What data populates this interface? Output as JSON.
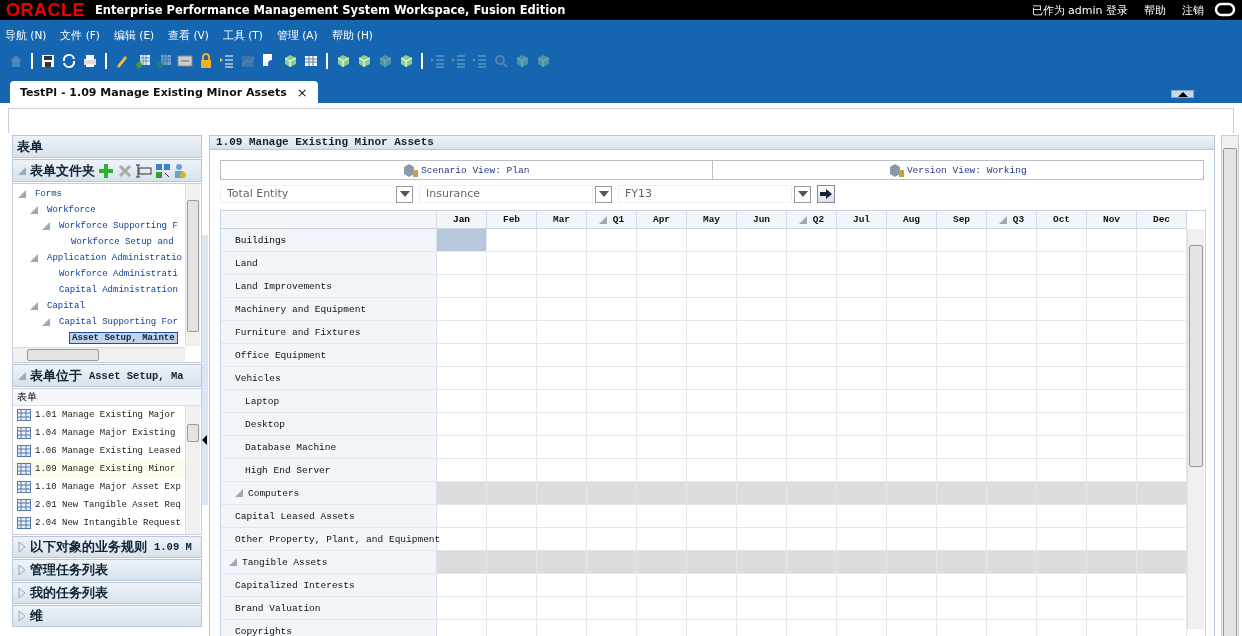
{
  "top_bar": {
    "logo": "ORACLE",
    "title": "Enterprise Performance Management System Workspace, Fusion Edition",
    "links": [
      "已作为 admin 登录",
      "帮助",
      "注销"
    ]
  },
  "menu": [
    "导航 (N)",
    "文件 (F)",
    "编辑 (E)",
    "查看 (V)",
    "工具 (T)",
    "管理 (A)",
    "帮助 (H)"
  ],
  "tabs": [
    {
      "label": "TestPl - 1.09 Manage Existing Minor Assets",
      "close": "×",
      "selected": true
    }
  ],
  "left_panel": {
    "title": "表单",
    "folder_section": {
      "title": "表单文件夹",
      "expanded": true,
      "tree": [
        {
          "label": "Forms",
          "expanded": true,
          "selected": false,
          "children": [
            {
              "label": "Workforce",
              "expanded": true,
              "selected": false,
              "children": [
                {
                  "label": "Workforce Supporting F",
                  "expanded": true,
                  "selected": false,
                  "children": [
                    {
                      "label": "Workforce Setup and",
                      "selected": false
                    }
                  ]
                }
              ]
            },
            {
              "label": "Application Administratio",
              "expanded": true,
              "selected": false,
              "children": [
                {
                  "label": "Workforce Administrati",
                  "selected": false
                },
                {
                  "label": "Capital Administration",
                  "selected": false
                }
              ]
            },
            {
              "label": "Capital",
              "expanded": true,
              "selected": false,
              "children": [
                {
                  "label": "Capital Supporting For",
                  "expanded": true,
                  "selected": false,
                  "children": [
                    {
                      "label": "Asset Setup, Mainte",
                      "selected": true
                    }
                  ]
                }
              ]
            }
          ]
        }
      ]
    },
    "forms_section": {
      "title": "表单位于",
      "subject": "Asset Setup, Ma",
      "expanded": true,
      "column": "表单",
      "items": [
        {
          "label": "1.01 Manage Existing Major",
          "selected": false
        },
        {
          "label": "1.04 Manage Major Existing",
          "selected": false
        },
        {
          "label": "1.06 Manage Existing Leased",
          "selected": false
        },
        {
          "label": "1.09 Manage Existing Minor",
          "selected": true
        },
        {
          "label": "1.10 Manage Major Asset Exp",
          "selected": false
        },
        {
          "label": "2.01 New Tangible Asset Req",
          "selected": false
        },
        {
          "label": "2.04 New Intangible Request",
          "selected": false
        }
      ]
    },
    "other_sections": [
      {
        "title": "以下对象的业务规则",
        "subject": "1.09 M",
        "expanded": false
      },
      {
        "title": "管理任务列表",
        "expanded": false
      },
      {
        "title": "我的任务列表",
        "expanded": false
      },
      {
        "title": "维",
        "expanded": false
      }
    ]
  },
  "main": {
    "title": "1.09 Manage Existing Minor Assets",
    "pov": [
      {
        "label": "Scenario View: Plan"
      },
      {
        "label": "Version View: Working"
      }
    ],
    "dropdowns": [
      {
        "value": "Total Entity"
      },
      {
        "value": "Insurance"
      },
      {
        "value": "FY13"
      }
    ],
    "grid": {
      "columns": [
        {
          "label": "Jan",
          "kind": "month",
          "selected": true
        },
        {
          "label": "Feb",
          "kind": "month",
          "selected": false
        },
        {
          "label": "Mar",
          "kind": "month",
          "selected": false
        },
        {
          "label": "Q1",
          "kind": "quarter",
          "selected": false
        },
        {
          "label": "Apr",
          "kind": "month",
          "selected": false
        },
        {
          "label": "May",
          "kind": "month",
          "selected": false
        },
        {
          "label": "Jun",
          "kind": "month",
          "selected": false
        },
        {
          "label": "Q2",
          "kind": "quarter",
          "selected": false
        },
        {
          "label": "Jul",
          "kind": "month",
          "selected": false
        },
        {
          "label": "Aug",
          "kind": "month",
          "selected": false
        },
        {
          "label": "Sep",
          "kind": "month",
          "selected": false
        },
        {
          "label": "Q3",
          "kind": "quarter",
          "selected": false
        },
        {
          "label": "Oct",
          "kind": "month",
          "selected": false
        },
        {
          "label": "Nov",
          "kind": "month",
          "selected": false
        },
        {
          "label": "Dec",
          "kind": "month",
          "selected": false
        }
      ],
      "rows": [
        {
          "label": "Tangible Assets",
          "expanded": true,
          "selected": false,
          "children": [
            {
              "label": "Buildings",
              "selected": true
            },
            {
              "label": "Land",
              "selected": false
            },
            {
              "label": "Land Improvements",
              "selected": false
            },
            {
              "label": "Machinery and Equipment",
              "selected": false
            },
            {
              "label": "Furniture and Fixtures",
              "selected": false
            },
            {
              "label": "Office Equipment",
              "selected": false
            },
            {
              "label": "Vehicles",
              "selected": false
            },
            {
              "label": "Computers",
              "expanded": true,
              "selected": false,
              "children": [
                {
                  "label": "Laptop",
                  "selected": false
                },
                {
                  "label": "Desktop",
                  "selected": false
                },
                {
                  "label": "Database Machine",
                  "selected": false
                },
                {
                  "label": "High End Server",
                  "selected": false
                }
              ]
            },
            {
              "label": "Capital Leased Assets",
              "selected": false
            },
            {
              "label": "Other Property, Plant, and Equipment",
              "selected": false
            }
          ]
        },
        {
          "label": "Capitalized Interests",
          "selected": false
        },
        {
          "label": "Brand Valuation",
          "selected": false
        },
        {
          "label": "Copyrights",
          "selected": false
        }
      ]
    }
  }
}
